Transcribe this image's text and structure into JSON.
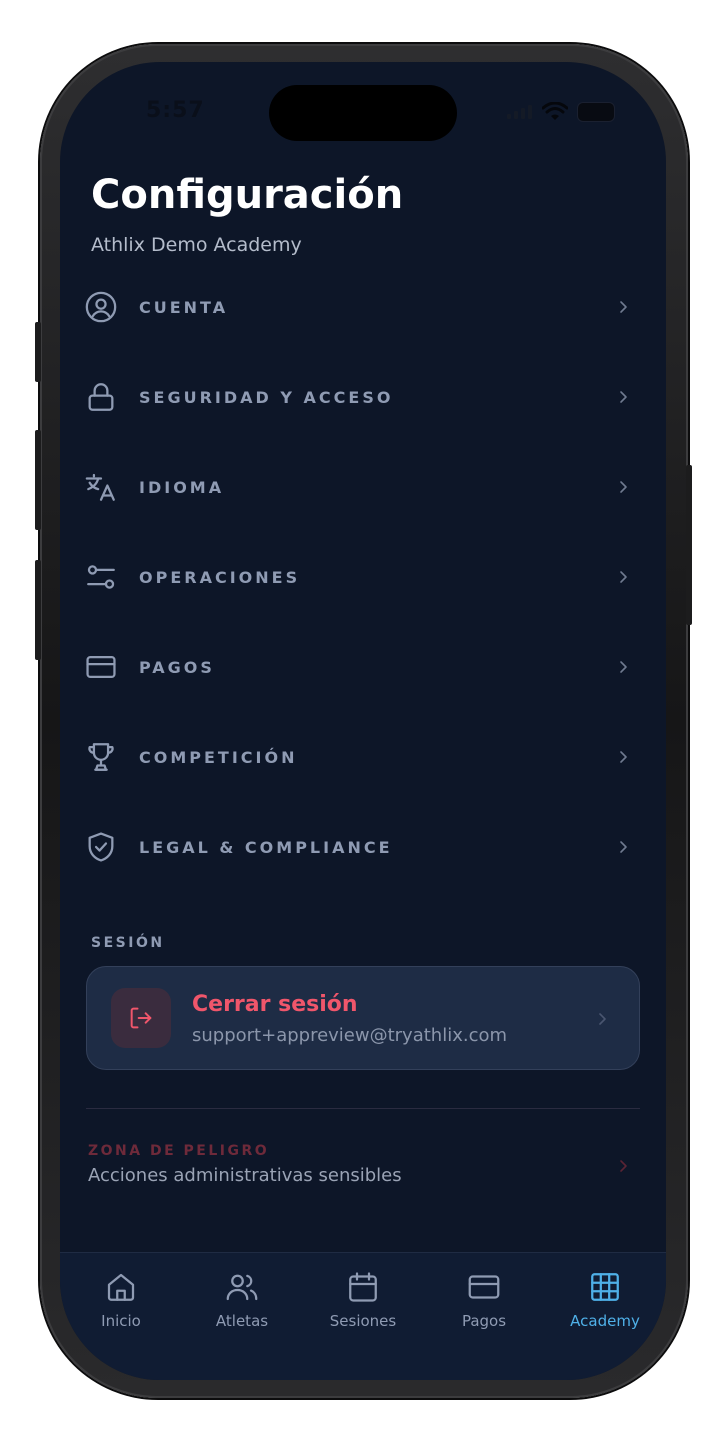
{
  "status_bar": {
    "time": "5:57"
  },
  "header": {
    "title": "Configuración",
    "subtitle": "Athlix Demo Academy"
  },
  "menu": {
    "items": [
      {
        "label": "CUENTA",
        "icon": "user-circle-icon"
      },
      {
        "label": "SEGURIDAD Y ACCESO",
        "icon": "lock-icon"
      },
      {
        "label": "IDIOMA",
        "icon": "translate-icon"
      },
      {
        "label": "OPERACIONES",
        "icon": "sliders-icon"
      },
      {
        "label": "PAGOS",
        "icon": "credit-card-icon"
      },
      {
        "label": "COMPETICIÓN",
        "icon": "trophy-icon"
      },
      {
        "label": "LEGAL & COMPLIANCE",
        "icon": "shield-check-icon"
      }
    ]
  },
  "session": {
    "section_label": "SESIÓN",
    "logout_title": "Cerrar sesión",
    "logout_email": "support+appreview@tryathlix.com"
  },
  "danger": {
    "label": "ZONA DE PELIGRO",
    "description": "Acciones administrativas sensibles"
  },
  "tabbar": {
    "tabs": [
      {
        "label": "Inicio",
        "icon": "home-icon"
      },
      {
        "label": "Atletas",
        "icon": "users-icon"
      },
      {
        "label": "Sesiones",
        "icon": "calendar-icon"
      },
      {
        "label": "Pagos",
        "icon": "credit-card-icon"
      },
      {
        "label": "Academy",
        "icon": "grid-icon",
        "active": true
      }
    ]
  },
  "colors": {
    "background": "#0d1628",
    "accent": "#4fb0e8",
    "danger": "#f0566b",
    "muted_text": "#8f9bb3"
  }
}
